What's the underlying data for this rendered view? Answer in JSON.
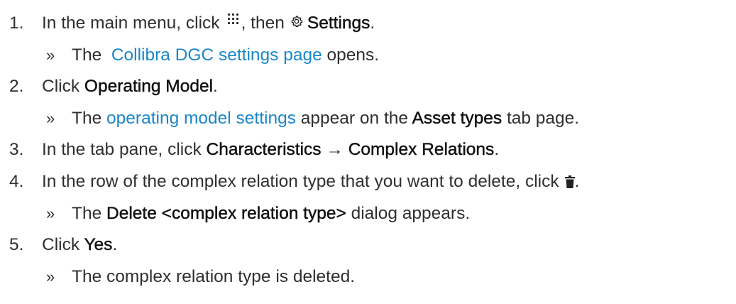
{
  "steps": [
    {
      "number": "1.",
      "text_a": "In the main menu, click",
      "text_b": ", then",
      "text_c": "Settings",
      "text_d": ".",
      "result": {
        "marker": "»",
        "text_a": "The",
        "link": "Collibra DGC settings page",
        "text_b": "opens."
      }
    },
    {
      "number": "2.",
      "text_a": "Click",
      "text_b": "Operating Model",
      "text_c": ".",
      "result": {
        "marker": "»",
        "text_a": "The",
        "link": "operating model settings",
        "text_b": "appear on the",
        "bold": "Asset types",
        "text_c": "tab page."
      }
    },
    {
      "number": "3.",
      "text_a": "In the tab pane, click",
      "text_b": "Characteristics",
      "arrow": "→",
      "text_c": "Complex Relations",
      "text_d": "."
    },
    {
      "number": "4.",
      "text_a": "In the row of the complex relation type that you want to delete, click",
      "text_b": ".",
      "result": {
        "marker": "»",
        "text_a": "The",
        "bold": "Delete <complex relation type>",
        "text_b": "dialog appears."
      }
    },
    {
      "number": "5.",
      "text_a": "Click",
      "text_b": "Yes",
      "text_c": ".",
      "result": {
        "marker": "»",
        "text_a": "The complex relation type is deleted."
      }
    }
  ],
  "colors": {
    "text": "#2f2f2f",
    "bold": "#111111",
    "link": "#1a86c9"
  },
  "icons": {
    "main_menu": "grid-icon",
    "settings": "gear-icon",
    "delete": "trash-icon"
  }
}
